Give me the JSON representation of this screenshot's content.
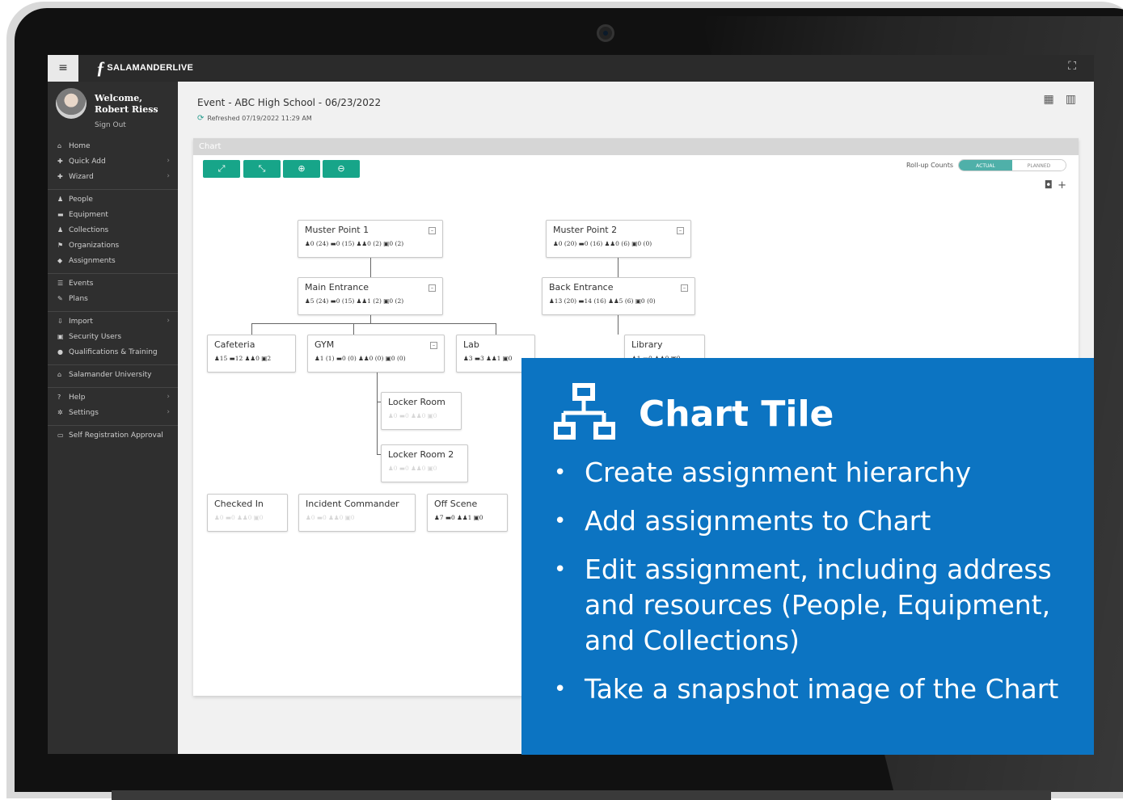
{
  "app": {
    "logo_text": "SALAMANDERLIVE",
    "logo_mark": "ƒ",
    "menu_icon": "hamburger-icon",
    "fullscreen_icon": "fullscreen-icon"
  },
  "profile": {
    "welcome": "Welcome,",
    "name": "Robert Riess",
    "sign_out": "Sign Out"
  },
  "nav": {
    "group1": [
      {
        "label": "Home",
        "icon": "home-icon"
      },
      {
        "label": "Quick Add",
        "icon": "plus-icon",
        "chevron": true
      },
      {
        "label": "Wizard",
        "icon": "plus-icon",
        "chevron": true
      }
    ],
    "group2": [
      {
        "label": "People",
        "icon": "person-icon"
      },
      {
        "label": "Equipment",
        "icon": "truck-icon"
      },
      {
        "label": "Collections",
        "icon": "group-icon"
      },
      {
        "label": "Organizations",
        "icon": "flag-icon"
      },
      {
        "label": "Assignments",
        "icon": "tag-icon"
      }
    ],
    "group3": [
      {
        "label": "Events",
        "icon": "list-icon"
      },
      {
        "label": "Plans",
        "icon": "edit-icon"
      }
    ],
    "group4": [
      {
        "label": "Import",
        "icon": "import-icon",
        "chevron": true
      },
      {
        "label": "Security Users",
        "icon": "lock-icon"
      },
      {
        "label": "Qualifications & Training",
        "icon": "badge-icon"
      }
    ],
    "group5": [
      {
        "label": "Salamander University",
        "icon": "university-icon"
      }
    ],
    "group6": [
      {
        "label": "Help",
        "icon": "help-icon",
        "chevron": true
      },
      {
        "label": "Settings",
        "icon": "gear-icon",
        "chevron": true
      }
    ],
    "group7": [
      {
        "label": "Self Registration Approval",
        "icon": "card-icon"
      }
    ]
  },
  "main": {
    "title": "Event - ABC High School - 06/23/2022",
    "refreshed": "Refreshed 07/19/2022 11:29 AM",
    "chart_header": "Chart",
    "toolbar": [
      "expand-icon",
      "collapse-icon",
      "zoom-in-icon",
      "zoom-out-icon"
    ],
    "rollup_label": "Roll-up Counts",
    "rollup_actual": "ACTUAL",
    "rollup_planned": "PLANNED"
  },
  "nodes": {
    "mp1": {
      "title": "Muster Point 1",
      "counts": "♟0 (24)  ▬0 (15)  ♟♟0 (2)  ▣0 (2)"
    },
    "mp2": {
      "title": "Muster Point 2",
      "counts": "♟0 (20)  ▬0 (16)  ♟♟0 (6)  ▣0 (0)"
    },
    "main_entrance": {
      "title": "Main Entrance",
      "counts": "♟5 (24)  ▬0 (15)  ♟♟1 (2)  ▣0 (2)"
    },
    "back_entrance": {
      "title": "Back Entrance",
      "counts": "♟13 (20)  ▬14 (16)  ♟♟5 (6)  ▣0 (0)"
    },
    "cafeteria": {
      "title": "Cafeteria",
      "counts": "♟15  ▬12  ♟♟0  ▣2"
    },
    "gym": {
      "title": "GYM",
      "counts": "♟1 (1)  ▬0 (0)  ♟♟0 (0)  ▣0 (0)"
    },
    "lab": {
      "title": "Lab",
      "counts": "♟3  ▬3  ♟♟1  ▣0"
    },
    "library": {
      "title": "Library",
      "counts": "♟1  ▬0  ♟♟0  ▣0"
    },
    "locker_room": {
      "title": "Locker Room",
      "counts": "♟0  ▬0  ♟♟0  ▣0"
    },
    "locker_room_2": {
      "title": "Locker Room 2",
      "counts": "♟0  ▬0  ♟♟0  ▣0"
    },
    "checked_in": {
      "title": "Checked In",
      "counts": "♟0  ▬0  ♟♟0  ▣0"
    },
    "incident_commander": {
      "title": "Incident Commander",
      "counts": "♟0  ▬0  ♟♟0  ▣0"
    },
    "off_scene": {
      "title": "Off Scene",
      "counts": "♟7  ▬0  ♟♟1  ▣0"
    }
  },
  "overlay": {
    "icon": "hierarchy-icon",
    "title": "Chart Tile",
    "bullets": [
      "Create assignment hierarchy",
      "Add assignments to Chart",
      "Edit assignment, including address and resources (People, Equipment, and Collections)",
      "Take a snapshot image of the Chart"
    ]
  }
}
